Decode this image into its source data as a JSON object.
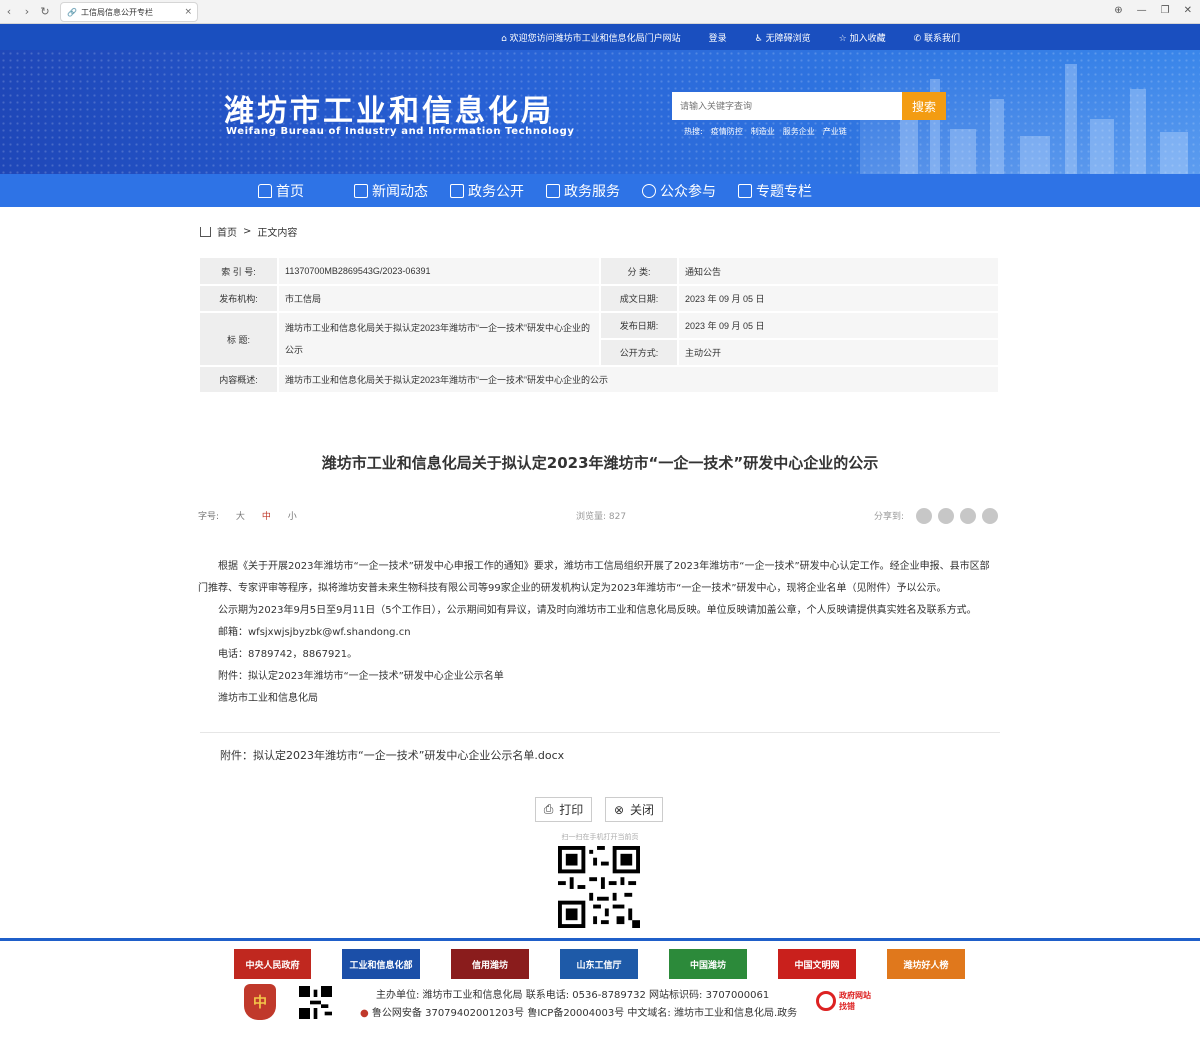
{
  "browser": {
    "tab_title": "工信局信息公开专栏"
  },
  "topbar": {
    "welcome": "欢迎您访问潍坊市工业和信息化局门户网站",
    "login": "登录",
    "accessible": "无障碍浏览",
    "favorite": "加入收藏",
    "contact": "联系我们"
  },
  "header": {
    "title": "潍坊市工业和信息化局",
    "subtitle": "Weifang Bureau of Industry and Information Technology",
    "search_placeholder": "请输入关键字查询",
    "search_button": "搜索",
    "hot_label": "热搜:",
    "hot_terms": [
      "疫情防控",
      "制造业",
      "服务企业",
      "产业链"
    ]
  },
  "nav": [
    "首页",
    "新闻动态",
    "政务公开",
    "政务服务",
    "公众参与",
    "专题专栏"
  ],
  "breadcrumb": {
    "home": "首页",
    "sep": ">",
    "current": "正文内容"
  },
  "info": {
    "index_label": "索 引 号:",
    "index_value": "11370700MB2869543G/2023-06391",
    "category_label": "分    类:",
    "category_value": "通知公告",
    "org_label": "发布机构:",
    "org_value": "市工信局",
    "created_label": "成文日期:",
    "created_value": "2023 年 09 月 05 日",
    "title_label": "标    题:",
    "title_value": "潍坊市工业和信息化局关于拟认定2023年潍坊市“一企一技术”研发中心企业的公示",
    "published_label": "发布日期:",
    "published_value": "2023 年 09 月 05 日",
    "mode_label": "公开方式:",
    "mode_value": "主动公开",
    "summary_label": "内容概述:",
    "summary_value": "潍坊市工业和信息化局关于拟认定2023年潍坊市“一企一技术”研发中心企业的公示"
  },
  "article": {
    "title": "潍坊市工业和信息化局关于拟认定2023年潍坊市“一企一技术”研发中心企业的公示",
    "font_size_label": "字号:",
    "font_large": "大",
    "font_medium": "中",
    "font_small": "小",
    "views": "浏览量: 827",
    "share_label": "分享到:",
    "p1": "根据《关于开展2023年潍坊市“一企一技术”研发中心申报工作的通知》要求，潍坊市工信局组织开展了2023年潍坊市“一企一技术”研发中心认定工作。经企业申报、县市区部门推荐、专家评审等程序，拟将潍坊安普未来生物科技有限公司等99家企业的研发机构认定为2023年潍坊市“一企一技术”研发中心，现将企业名单（见附件）予以公示。",
    "p2": "公示期为2023年9月5日至9月11日（5个工作日），公示期间如有异议，请及时向潍坊市工业和信息化局反映。单位反映请加盖公章，个人反映请提供真实姓名及联系方式。",
    "p3": "邮箱：wfsjxwjsjbyzbk@wf.shandong.cn",
    "p4": "电话：8789742，8867921。",
    "p5": "附件：拟认定2023年潍坊市“一企一技术”研发中心企业公示名单",
    "p6": "潍坊市工业和信息化局",
    "attachment": "附件：拟认定2023年潍坊市“一企一技术”研发中心企业公示名单.docx",
    "print": "打印",
    "close": "关闭",
    "scan_hint": "扫一扫在手机打开当前页"
  },
  "footer": {
    "links": [
      {
        "label": "中央人民政府",
        "color": "#c0281f"
      },
      {
        "label": "工业和信息化部",
        "color": "#1b4fa8"
      },
      {
        "label": "信用潍坊",
        "color": "#8a1c1c"
      },
      {
        "label": "山东工信厅",
        "color": "#1e5aa8"
      },
      {
        "label": "中国潍坊",
        "color": "#2c8a3a"
      },
      {
        "label": "中国文明网",
        "color": "#c9201c"
      },
      {
        "label": "潍坊好人榜",
        "color": "#e0781c"
      }
    ],
    "badge_char": "中",
    "line1": "主办单位:  潍坊市工业和信息化局  联系电话: 0536-8789732  网站标识码: 3707000061",
    "line2": "鲁公网安备 37079402001203号  鲁ICP备20004003号  中文域名:  潍坊市工业和信息化局.政务",
    "gov_error_1": "政府网站",
    "gov_error_2": "找错"
  }
}
